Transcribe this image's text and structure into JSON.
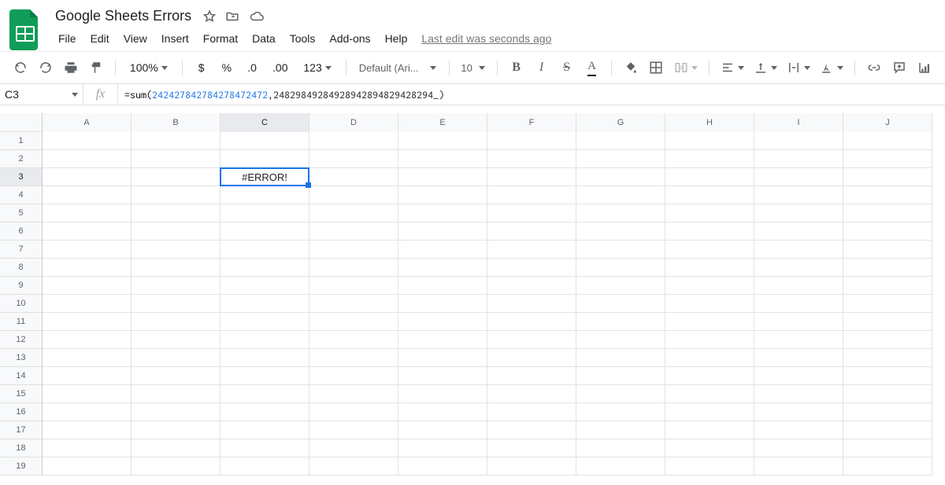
{
  "doc_title": "Google Sheets Errors",
  "menu": [
    "File",
    "Edit",
    "View",
    "Insert",
    "Format",
    "Data",
    "Tools",
    "Add-ons",
    "Help"
  ],
  "last_edit": "Last edit was seconds ago",
  "toolbar": {
    "zoom": "100%",
    "currency": "$",
    "percent": "%",
    "dec_dec": ".0",
    "inc_dec": ".00",
    "more_formats": "123",
    "font": "Default (Ari...",
    "font_size": "10",
    "bold": "B",
    "italic": "I",
    "strike": "S",
    "text_color": "A"
  },
  "name_box": "C3",
  "formula": {
    "prefix": "=sum(",
    "arg1": "242427842784278472472",
    "sep": ",",
    "arg2": "24829849284928942894829428294_",
    "suffix": ")"
  },
  "columns": [
    "A",
    "B",
    "C",
    "D",
    "E",
    "F",
    "G",
    "H",
    "I",
    "J"
  ],
  "rows": [
    "1",
    "2",
    "3",
    "4",
    "5",
    "6",
    "7",
    "8",
    "9",
    "10",
    "11",
    "12",
    "13",
    "14",
    "15",
    "16",
    "17",
    "18",
    "19"
  ],
  "active_cell": {
    "col_index": 2,
    "row_index": 2,
    "value": "#ERROR!"
  }
}
